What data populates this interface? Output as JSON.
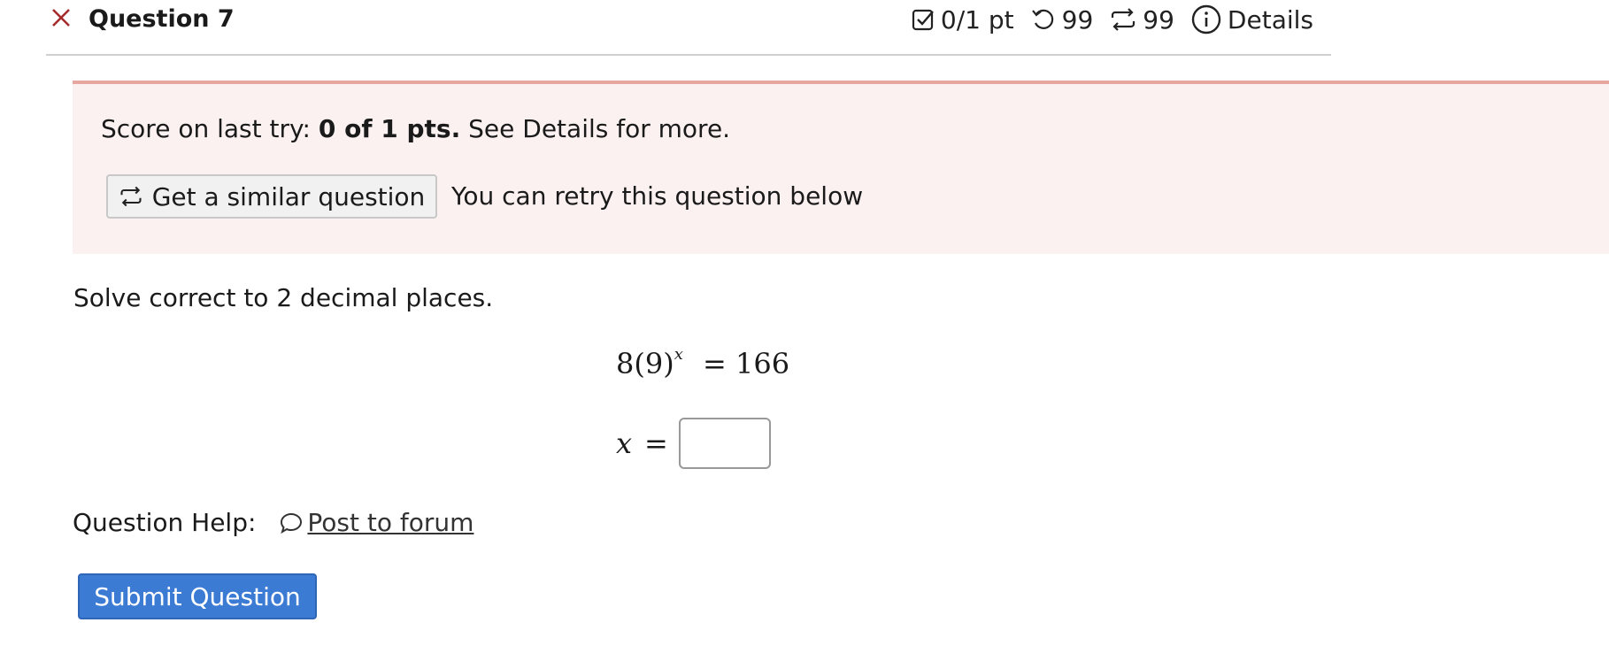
{
  "header": {
    "title": "Question 7",
    "points": "0/1 pt",
    "retries": "99",
    "similar_count": "99",
    "details_label": "Details"
  },
  "banner": {
    "score_prefix": "Score on last try:",
    "score_value": "0 of 1 pts.",
    "score_suffix": "See Details for more.",
    "similar_button": "Get a similar question",
    "retry_text": "You can retry this question below"
  },
  "question": {
    "prompt": "Solve correct to 2 decimal places.",
    "equation_base": "8(9)",
    "equation_exponent": "x",
    "equation_rhs": "= 166",
    "answer_label": "x",
    "answer_eq": "=",
    "answer_value": ""
  },
  "help": {
    "label": "Question Help:",
    "forum_link": "Post to forum"
  },
  "submit_label": "Submit Question",
  "colors": {
    "close_x": "#a52a2a",
    "banner_bg": "#fcf1f1",
    "banner_border": "#e8a79e",
    "submit_bg": "#3b7bd4"
  }
}
